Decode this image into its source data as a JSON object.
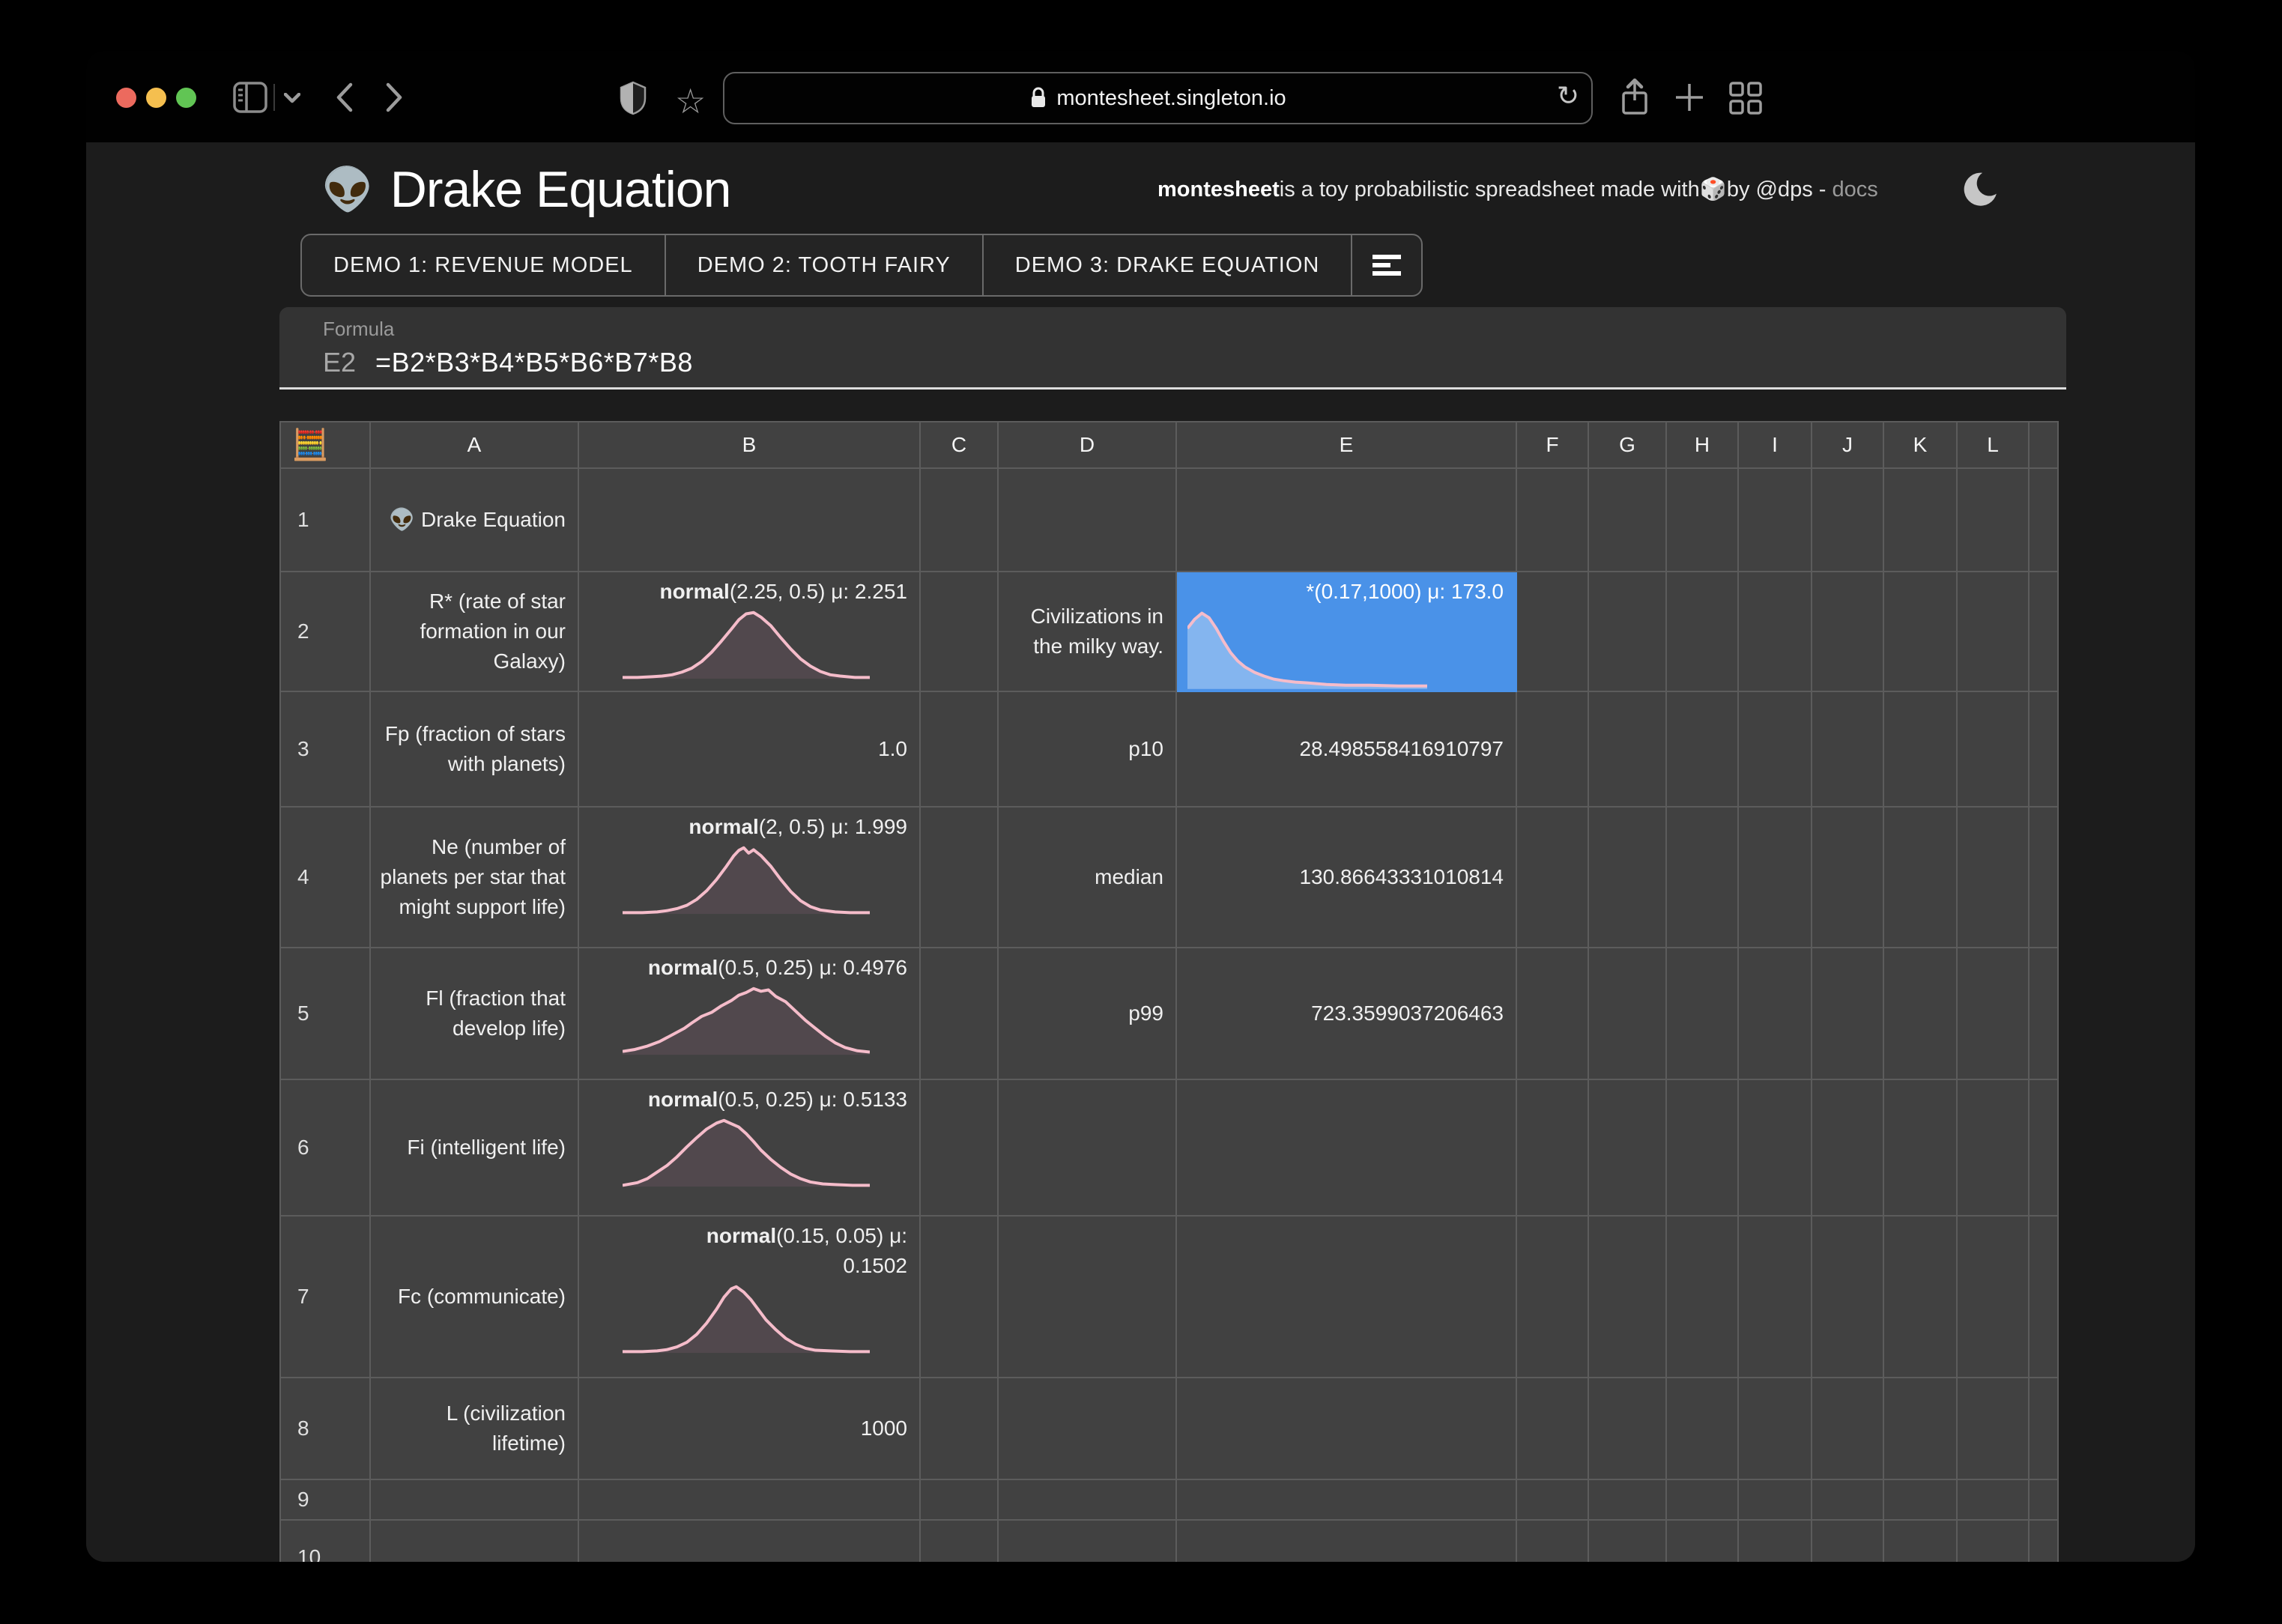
{
  "browser": {
    "url": "montesheet.singleton.io",
    "traffic_lights": [
      "#ec6a5e",
      "#f5bf4f",
      "#61c554"
    ]
  },
  "header": {
    "emoji": "👽",
    "title": "Drake Equation",
    "tagline_bold": "montesheet",
    "tagline_mid": " is a toy probabilistic spreadsheet made with ",
    "tagline_emoji": "🎲",
    "tagline_after": " by @dps - ",
    "tagline_link": "docs"
  },
  "tabs": [
    {
      "label": "DEMO 1: REVENUE MODEL"
    },
    {
      "label": "DEMO 2: TOOTH FAIRY"
    },
    {
      "label": "DEMO 3: DRAKE EQUATION"
    }
  ],
  "formula_bar": {
    "label": "Formula",
    "cell_ref": "E2",
    "formula": "=B2*B3*B4*B5*B6*B7*B8"
  },
  "sheet": {
    "corner_icon": "🧮",
    "columns": [
      "A",
      "B",
      "C",
      "D",
      "E",
      "F",
      "G",
      "H",
      "I",
      "J",
      "K",
      "L",
      ""
    ],
    "selected_cell": "E2",
    "selection_color": "#4a92e8",
    "curve_stroke": "#f5bcca",
    "rows": [
      {
        "n": "1",
        "cells": [
          {
            "col": "A",
            "type": "text",
            "text": "👽 Drake Equation"
          }
        ]
      },
      {
        "n": "2",
        "cells": [
          {
            "col": "A",
            "type": "text",
            "text": "R* (rate of star formation in our Galaxy)"
          },
          {
            "col": "B",
            "type": "dist",
            "bold": "normal",
            "label": "(2.25, 0.5) μ: 2.251",
            "curve": [
              [
                0,
                2
              ],
              [
                6,
                2
              ],
              [
                12,
                3
              ],
              [
                16,
                4
              ],
              [
                20,
                6
              ],
              [
                24,
                10
              ],
              [
                28,
                16
              ],
              [
                32,
                26
              ],
              [
                36,
                40
              ],
              [
                40,
                57
              ],
              [
                44,
                75
              ],
              [
                47,
                89
              ],
              [
                50,
                98
              ],
              [
                53,
                100
              ],
              [
                56,
                93
              ],
              [
                60,
                80
              ],
              [
                64,
                62
              ],
              [
                68,
                45
              ],
              [
                72,
                30
              ],
              [
                76,
                19
              ],
              [
                80,
                11
              ],
              [
                84,
                6
              ],
              [
                88,
                4
              ],
              [
                94,
                2
              ],
              [
                100,
                2
              ]
            ]
          },
          {
            "col": "D",
            "type": "text",
            "text": "Civilizations in the milky way."
          },
          {
            "col": "E",
            "type": "dist",
            "bold": "",
            "label": "*(0.17,1000) μ: 173.0",
            "selected": true,
            "curve": [
              [
                0,
                80
              ],
              [
                3,
                92
              ],
              [
                6,
                100
              ],
              [
                9,
                94
              ],
              [
                12,
                80
              ],
              [
                15,
                63
              ],
              [
                18,
                48
              ],
              [
                21,
                37
              ],
              [
                24,
                29
              ],
              [
                28,
                22
              ],
              [
                32,
                17
              ],
              [
                36,
                13
              ],
              [
                40,
                11
              ],
              [
                45,
                9
              ],
              [
                50,
                8
              ],
              [
                58,
                6
              ],
              [
                66,
                5
              ],
              [
                76,
                5
              ],
              [
                88,
                4
              ],
              [
                100,
                4
              ]
            ]
          }
        ]
      },
      {
        "n": "3",
        "cells": [
          {
            "col": "A",
            "type": "text",
            "text": "Fp (fraction of stars with planets)"
          },
          {
            "col": "B",
            "type": "text",
            "text": "1.0"
          },
          {
            "col": "D",
            "type": "text",
            "text": "p10"
          },
          {
            "col": "E",
            "type": "text",
            "text": "28.498558416910797"
          }
        ]
      },
      {
        "n": "4",
        "cells": [
          {
            "col": "A",
            "type": "text",
            "text": "Ne (number of planets per star that might support life)"
          },
          {
            "col": "B",
            "type": "dist",
            "bold": "normal",
            "label": "(2, 0.5) μ: 1.999",
            "curve": [
              [
                0,
                2
              ],
              [
                8,
                2
              ],
              [
                14,
                3
              ],
              [
                18,
                5
              ],
              [
                22,
                8
              ],
              [
                26,
                13
              ],
              [
                30,
                22
              ],
              [
                34,
                35
              ],
              [
                38,
                52
              ],
              [
                42,
                72
              ],
              [
                45,
                88
              ],
              [
                47,
                96
              ],
              [
                49,
                100
              ],
              [
                51,
                92
              ],
              [
                53,
                97
              ],
              [
                56,
                88
              ],
              [
                60,
                72
              ],
              [
                64,
                52
              ],
              [
                68,
                34
              ],
              [
                72,
                20
              ],
              [
                76,
                11
              ],
              [
                80,
                6
              ],
              [
                86,
                3
              ],
              [
                92,
                2
              ],
              [
                100,
                2
              ]
            ]
          },
          {
            "col": "D",
            "type": "text",
            "text": "median"
          },
          {
            "col": "E",
            "type": "text",
            "text": "130.86643331010814"
          }
        ]
      },
      {
        "n": "5",
        "cells": [
          {
            "col": "A",
            "type": "text",
            "text": "Fl (fraction that develop life)"
          },
          {
            "col": "B",
            "type": "dist",
            "bold": "normal",
            "label": "(0.5, 0.25) μ: 0.4976",
            "curve": [
              [
                0,
                5
              ],
              [
                5,
                8
              ],
              [
                10,
                13
              ],
              [
                15,
                20
              ],
              [
                20,
                30
              ],
              [
                25,
                40
              ],
              [
                28,
                48
              ],
              [
                32,
                58
              ],
              [
                36,
                64
              ],
              [
                40,
                74
              ],
              [
                44,
                82
              ],
              [
                47,
                90
              ],
              [
                50,
                94
              ],
              [
                53,
                100
              ],
              [
                56,
                96
              ],
              [
                59,
                98
              ],
              [
                62,
                88
              ],
              [
                66,
                80
              ],
              [
                70,
                66
              ],
              [
                74,
                52
              ],
              [
                78,
                40
              ],
              [
                82,
                28
              ],
              [
                86,
                18
              ],
              [
                90,
                11
              ],
              [
                95,
                6
              ],
              [
                100,
                4
              ]
            ]
          },
          {
            "col": "D",
            "type": "text",
            "text": "p99"
          },
          {
            "col": "E",
            "type": "text",
            "text": "723.3599037206463"
          }
        ]
      },
      {
        "n": "6",
        "cells": [
          {
            "col": "A",
            "type": "text",
            "text": "Fi (intelligent life)"
          },
          {
            "col": "B",
            "type": "dist",
            "bold": "normal",
            "label": "(0.5, 0.25) μ: 0.5133",
            "curve": [
              [
                0,
                2
              ],
              [
                6,
                6
              ],
              [
                10,
                12
              ],
              [
                14,
                22
              ],
              [
                18,
                32
              ],
              [
                22,
                45
              ],
              [
                26,
                60
              ],
              [
                30,
                74
              ],
              [
                34,
                87
              ],
              [
                38,
                96
              ],
              [
                41,
                100
              ],
              [
                44,
                95
              ],
              [
                47,
                90
              ],
              [
                50,
                80
              ],
              [
                53,
                68
              ],
              [
                56,
                55
              ],
              [
                60,
                41
              ],
              [
                64,
                29
              ],
              [
                68,
                19
              ],
              [
                72,
                12
              ],
              [
                76,
                7
              ],
              [
                81,
                4
              ],
              [
                86,
                3
              ],
              [
                93,
                2
              ],
              [
                100,
                2
              ]
            ]
          }
        ]
      },
      {
        "n": "7",
        "cells": [
          {
            "col": "A",
            "type": "text",
            "text": "Fc (communicate)"
          },
          {
            "col": "B",
            "type": "dist",
            "bold": "normal",
            "label": "(0.15, 0.05) μ:",
            "label2": "0.1502",
            "curve": [
              [
                0,
                2
              ],
              [
                8,
                2
              ],
              [
                14,
                3
              ],
              [
                18,
                5
              ],
              [
                22,
                9
              ],
              [
                26,
                16
              ],
              [
                30,
                28
              ],
              [
                34,
                45
              ],
              [
                38,
                66
              ],
              [
                41,
                84
              ],
              [
                44,
                97
              ],
              [
                46,
                100
              ],
              [
                49,
                92
              ],
              [
                52,
                80
              ],
              [
                55,
                65
              ],
              [
                58,
                50
              ],
              [
                62,
                35
              ],
              [
                66,
                22
              ],
              [
                70,
                13
              ],
              [
                74,
                7
              ],
              [
                78,
                4
              ],
              [
                84,
                3
              ],
              [
                92,
                2
              ],
              [
                100,
                2
              ]
            ]
          }
        ]
      },
      {
        "n": "8",
        "cells": [
          {
            "col": "A",
            "type": "text",
            "text": "L (civilization lifetime)"
          },
          {
            "col": "B",
            "type": "text",
            "text": "1000"
          }
        ]
      },
      {
        "n": "9",
        "cells": []
      },
      {
        "n": "10",
        "cells": []
      }
    ]
  }
}
